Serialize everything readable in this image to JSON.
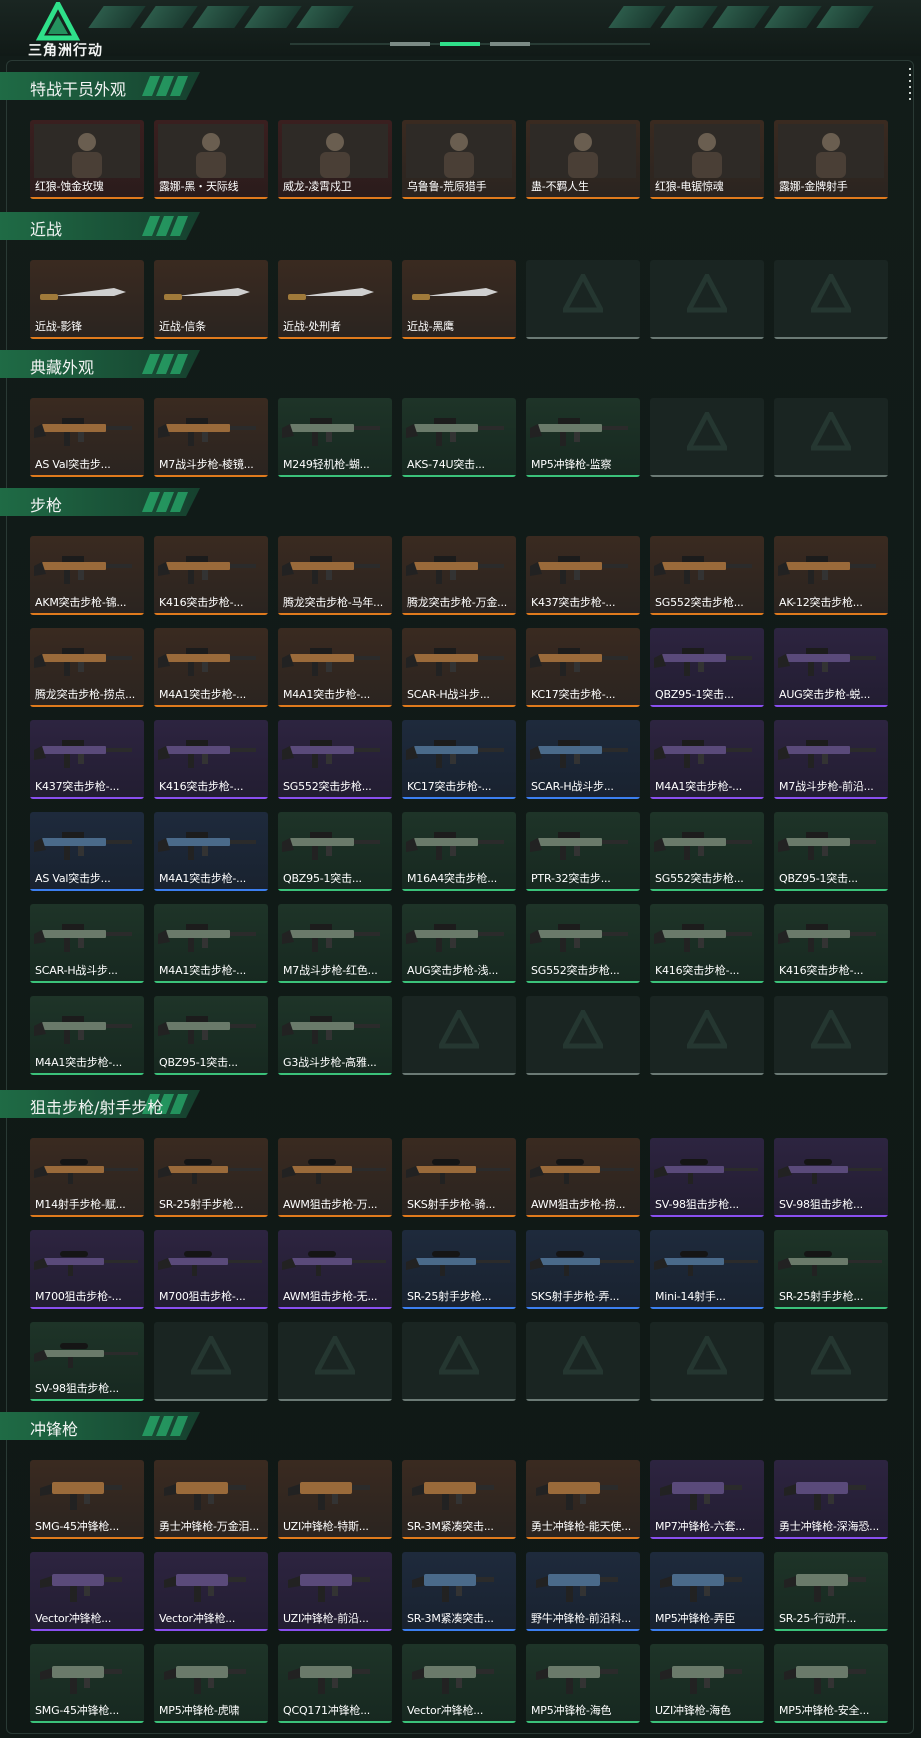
{
  "header": {
    "logo_text": "三角洲行动"
  },
  "colors": {
    "orange": "#e07a1d",
    "purple": "#8a4ff0",
    "blue": "#3c7ff0",
    "green": "#3bc27a",
    "empty": "#6b7a75"
  },
  "sections": [
    {
      "title": "特战干员外观",
      "items": [
        {
          "label": "红狼-蚀金玫瑰",
          "rarity": "red",
          "icon": "operator-portrait"
        },
        {
          "label": "露娜-黑・天际线",
          "rarity": "red",
          "icon": "operator-portrait"
        },
        {
          "label": "威龙-凌霄戍卫",
          "rarity": "red",
          "icon": "operator-portrait"
        },
        {
          "label": "乌鲁鲁-荒原猎手",
          "rarity": "orange",
          "icon": "operator-portrait"
        },
        {
          "label": "蛊-不羁人生",
          "rarity": "orange",
          "icon": "operator-portrait"
        },
        {
          "label": "红狼-电锯惊魂",
          "rarity": "orange",
          "icon": "operator-portrait"
        },
        {
          "label": "露娜-金牌射手",
          "rarity": "orange",
          "icon": "operator-portrait"
        }
      ]
    },
    {
      "title": "近战",
      "items": [
        {
          "label": "近战-影锋",
          "rarity": "orange",
          "icon": "knife"
        },
        {
          "label": "近战-信条",
          "rarity": "orange",
          "icon": "knife"
        },
        {
          "label": "近战-处刑者",
          "rarity": "orange",
          "icon": "knife"
        },
        {
          "label": "近战-黑鹰",
          "rarity": "orange",
          "icon": "knife"
        },
        {
          "label": "",
          "rarity": "empty"
        },
        {
          "label": "",
          "rarity": "empty"
        },
        {
          "label": "",
          "rarity": "empty"
        }
      ]
    },
    {
      "title": "典藏外观",
      "items": [
        {
          "label": "AS Val突击步...",
          "rarity": "orange",
          "icon": "rifle"
        },
        {
          "label": "M7战斗步枪-棱镜...",
          "rarity": "orange",
          "icon": "rifle"
        },
        {
          "label": "M249轻机枪-蝴...",
          "rarity": "green",
          "icon": "rifle"
        },
        {
          "label": "AKS-74U突击...",
          "rarity": "green",
          "icon": "rifle"
        },
        {
          "label": "MP5冲锋枪-监察",
          "rarity": "green",
          "icon": "rifle"
        },
        {
          "label": "",
          "rarity": "empty"
        },
        {
          "label": "",
          "rarity": "empty"
        }
      ]
    },
    {
      "title": "步枪",
      "items": [
        {
          "label": "AKM突击步枪-锦...",
          "rarity": "orange",
          "icon": "rifle"
        },
        {
          "label": "K416突击步枪-...",
          "rarity": "orange",
          "icon": "rifle"
        },
        {
          "label": "腾龙突击步枪-马年...",
          "rarity": "orange",
          "icon": "rifle"
        },
        {
          "label": "腾龙突击步枪-万金...",
          "rarity": "orange",
          "icon": "rifle"
        },
        {
          "label": "K437突击步枪-...",
          "rarity": "orange",
          "icon": "rifle"
        },
        {
          "label": "SG552突击步枪...",
          "rarity": "orange",
          "icon": "rifle"
        },
        {
          "label": "AK-12突击步枪...",
          "rarity": "orange",
          "icon": "rifle"
        },
        {
          "label": "腾龙突击步枪-捞点...",
          "rarity": "orange",
          "icon": "rifle"
        },
        {
          "label": "M4A1突击步枪-...",
          "rarity": "orange",
          "icon": "rifle"
        },
        {
          "label": "M4A1突击步枪-...",
          "rarity": "orange",
          "icon": "rifle"
        },
        {
          "label": "SCAR-H战斗步...",
          "rarity": "orange",
          "icon": "rifle"
        },
        {
          "label": "KC17突击步枪-...",
          "rarity": "orange",
          "icon": "rifle"
        },
        {
          "label": "QBZ95-1突击...",
          "rarity": "purple",
          "icon": "rifle"
        },
        {
          "label": "AUG突击步枪-蜕...",
          "rarity": "purple",
          "icon": "rifle"
        },
        {
          "label": "K437突击步枪-...",
          "rarity": "purple",
          "icon": "rifle"
        },
        {
          "label": "K416突击步枪-...",
          "rarity": "purple",
          "icon": "rifle"
        },
        {
          "label": "SG552突击步枪...",
          "rarity": "purple",
          "icon": "rifle"
        },
        {
          "label": "KC17突击步枪-...",
          "rarity": "blue",
          "icon": "rifle"
        },
        {
          "label": "SCAR-H战斗步...",
          "rarity": "blue",
          "icon": "rifle"
        },
        {
          "label": "M4A1突击步枪-...",
          "rarity": "purple",
          "icon": "rifle"
        },
        {
          "label": "M7战斗步枪-前沿...",
          "rarity": "purple",
          "icon": "rifle"
        },
        {
          "label": "AS Val突击步...",
          "rarity": "blue",
          "icon": "rifle"
        },
        {
          "label": "M4A1突击步枪-...",
          "rarity": "blue",
          "icon": "rifle"
        },
        {
          "label": "QBZ95-1突击...",
          "rarity": "green",
          "icon": "rifle"
        },
        {
          "label": "M16A4突击步枪...",
          "rarity": "green",
          "icon": "rifle"
        },
        {
          "label": "PTR-32突击步...",
          "rarity": "green",
          "icon": "rifle"
        },
        {
          "label": "SG552突击步枪...",
          "rarity": "green",
          "icon": "rifle"
        },
        {
          "label": "QBZ95-1突击...",
          "rarity": "green",
          "icon": "rifle"
        },
        {
          "label": "SCAR-H战斗步...",
          "rarity": "green",
          "icon": "rifle"
        },
        {
          "label": "M4A1突击步枪-...",
          "rarity": "green",
          "icon": "rifle"
        },
        {
          "label": "M7战斗步枪-红色...",
          "rarity": "green",
          "icon": "rifle"
        },
        {
          "label": "AUG突击步枪-浅...",
          "rarity": "green",
          "icon": "rifle"
        },
        {
          "label": "SG552突击步枪...",
          "rarity": "green",
          "icon": "rifle"
        },
        {
          "label": "K416突击步枪-...",
          "rarity": "green",
          "icon": "rifle"
        },
        {
          "label": "K416突击步枪-...",
          "rarity": "green",
          "icon": "rifle"
        },
        {
          "label": "M4A1突击步枪-...",
          "rarity": "green",
          "icon": "rifle"
        },
        {
          "label": "QBZ95-1突击...",
          "rarity": "green",
          "icon": "rifle"
        },
        {
          "label": "G3战斗步枪-高雅...",
          "rarity": "green",
          "icon": "rifle"
        },
        {
          "label": "",
          "rarity": "empty"
        },
        {
          "label": "",
          "rarity": "empty"
        },
        {
          "label": "",
          "rarity": "empty"
        },
        {
          "label": "",
          "rarity": "empty"
        }
      ]
    },
    {
      "title": "狙击步枪/射手步枪",
      "items": [
        {
          "label": "M14射手步枪-赋...",
          "rarity": "orange",
          "icon": "sniper"
        },
        {
          "label": "SR-25射手步枪...",
          "rarity": "orange",
          "icon": "sniper"
        },
        {
          "label": "AWM狙击步枪-万...",
          "rarity": "orange",
          "icon": "sniper"
        },
        {
          "label": "SKS射手步枪-骑...",
          "rarity": "orange",
          "icon": "sniper"
        },
        {
          "label": "AWM狙击步枪-捞...",
          "rarity": "orange",
          "icon": "sniper"
        },
        {
          "label": "SV-98狙击步枪...",
          "rarity": "purple",
          "icon": "sniper"
        },
        {
          "label": "SV-98狙击步枪...",
          "rarity": "purple",
          "icon": "sniper"
        },
        {
          "label": "M700狙击步枪-...",
          "rarity": "purple",
          "icon": "sniper"
        },
        {
          "label": "M700狙击步枪-...",
          "rarity": "purple",
          "icon": "sniper"
        },
        {
          "label": "AWM狙击步枪-无...",
          "rarity": "purple",
          "icon": "sniper"
        },
        {
          "label": "SR-25射手步枪...",
          "rarity": "blue",
          "icon": "sniper"
        },
        {
          "label": "SKS射手步枪-弄...",
          "rarity": "blue",
          "icon": "sniper"
        },
        {
          "label": "Mini-14射手...",
          "rarity": "blue",
          "icon": "sniper"
        },
        {
          "label": "SR-25射手步枪...",
          "rarity": "green",
          "icon": "sniper"
        },
        {
          "label": "SV-98狙击步枪...",
          "rarity": "green",
          "icon": "sniper"
        },
        {
          "label": "",
          "rarity": "empty"
        },
        {
          "label": "",
          "rarity": "empty"
        },
        {
          "label": "",
          "rarity": "empty"
        },
        {
          "label": "",
          "rarity": "empty"
        },
        {
          "label": "",
          "rarity": "empty"
        },
        {
          "label": "",
          "rarity": "empty"
        }
      ]
    },
    {
      "title": "冲锋枪",
      "items": [
        {
          "label": "SMG-45冲锋枪...",
          "rarity": "orange",
          "icon": "smg"
        },
        {
          "label": "勇士冲锋枪-万金泪...",
          "rarity": "orange",
          "icon": "smg"
        },
        {
          "label": "UZI冲锋枪-特斯...",
          "rarity": "orange",
          "icon": "smg"
        },
        {
          "label": "SR-3M紧凑突击...",
          "rarity": "orange",
          "icon": "smg"
        },
        {
          "label": "勇士冲锋枪-能天使...",
          "rarity": "orange",
          "icon": "smg"
        },
        {
          "label": "MP7冲锋枪-六套...",
          "rarity": "purple",
          "icon": "smg"
        },
        {
          "label": "勇士冲锋枪-深海恐...",
          "rarity": "purple",
          "icon": "smg"
        },
        {
          "label": "Vector冲锋枪...",
          "rarity": "purple",
          "icon": "smg"
        },
        {
          "label": "Vector冲锋枪...",
          "rarity": "purple",
          "icon": "smg"
        },
        {
          "label": "UZI冲锋枪-前沿...",
          "rarity": "purple",
          "icon": "smg"
        },
        {
          "label": "SR-3M紧凑突击...",
          "rarity": "blue",
          "icon": "smg"
        },
        {
          "label": "野牛冲锋枪-前沿科...",
          "rarity": "blue",
          "icon": "smg"
        },
        {
          "label": "MP5冲锋枪-弄臣",
          "rarity": "blue",
          "icon": "smg"
        },
        {
          "label": "SR-25-行动开...",
          "rarity": "green",
          "icon": "smg"
        },
        {
          "label": "SMG-45冲锋枪...",
          "rarity": "green",
          "icon": "smg"
        },
        {
          "label": "MP5冲锋枪-虎啸",
          "rarity": "green",
          "icon": "smg"
        },
        {
          "label": "QCQ171冲锋枪...",
          "rarity": "green",
          "icon": "smg"
        },
        {
          "label": "Vector冲锋枪...",
          "rarity": "green",
          "icon": "smg"
        },
        {
          "label": "MP5冲锋枪-海色",
          "rarity": "green",
          "icon": "smg"
        },
        {
          "label": "UZI冲锋枪-海色",
          "rarity": "green",
          "icon": "smg"
        },
        {
          "label": "MP5冲锋枪-安全...",
          "rarity": "green",
          "icon": "smg"
        }
      ]
    }
  ]
}
